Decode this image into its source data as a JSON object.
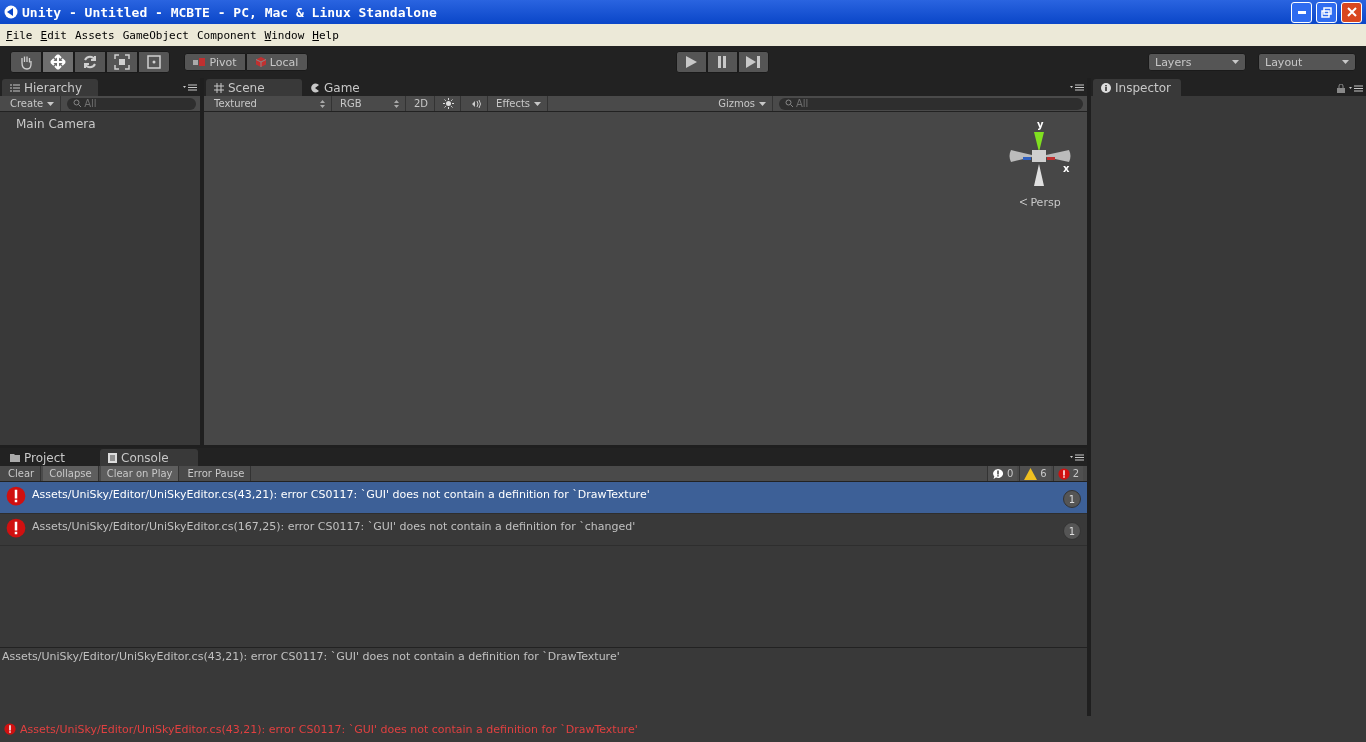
{
  "window": {
    "title": "Unity - Untitled - MCBTE - PC, Mac & Linux Standalone"
  },
  "menu": [
    {
      "label": "File",
      "mnemonic": true
    },
    {
      "label": "Edit",
      "mnemonic": true
    },
    {
      "label": "Assets",
      "mnemonic": false
    },
    {
      "label": "GameObject",
      "mnemonic": false
    },
    {
      "label": "Component",
      "mnemonic": false
    },
    {
      "label": "Window",
      "mnemonic": true
    },
    {
      "label": "Help",
      "mnemonic": true
    }
  ],
  "toolbar": {
    "tools": [
      {
        "kind": "hand",
        "selected": false
      },
      {
        "kind": "move",
        "selected": true
      },
      {
        "kind": "rotate",
        "selected": false
      },
      {
        "kind": "scale",
        "selected": false
      },
      {
        "kind": "rect",
        "selected": false
      }
    ],
    "pivot": "Pivot",
    "space": "Local",
    "playback": [
      {
        "kind": "play",
        "selected": false
      },
      {
        "kind": "pause",
        "selected": false
      },
      {
        "kind": "step",
        "selected": false
      }
    ],
    "layers": "Layers",
    "layout": "Layout"
  },
  "hierarchy": {
    "tab": "Hierarchy",
    "create": "Create",
    "search_placeholder": "All",
    "items": [
      "Main Camera"
    ]
  },
  "scene": {
    "tabs": [
      {
        "label": "Scene",
        "kind": "scene",
        "selected": true
      },
      {
        "label": "Game",
        "kind": "game",
        "selected": false
      }
    ],
    "draw_mode": "Textured",
    "render_mode": "RGB",
    "mode_2d": "2D",
    "mode_2d_on": false,
    "lighting_on": false,
    "audio_on": false,
    "effects": "Effects",
    "gizmos": "Gizmos",
    "search_placeholder": "All",
    "gizmo": {
      "y_label": "y",
      "x_label": "x",
      "projection": "Persp"
    }
  },
  "inspector": {
    "tab": "Inspector"
  },
  "console": {
    "tabs": [
      {
        "label": "Project",
        "kind": "project",
        "selected": false
      },
      {
        "label": "Console",
        "kind": "console",
        "selected": true
      }
    ],
    "buttons": [
      {
        "label": "Clear",
        "selected": false
      },
      {
        "label": "Collapse",
        "selected": true
      },
      {
        "label": "Clear on Play",
        "selected": true
      },
      {
        "label": "Error Pause",
        "selected": false
      }
    ],
    "counters": [
      {
        "kind": "info",
        "count": "0"
      },
      {
        "kind": "warning",
        "count": "6"
      },
      {
        "kind": "error",
        "count": "2"
      }
    ],
    "entries": [
      {
        "message": "Assets/UniSky/Editor/UniSkyEditor.cs(43,21): error CS0117: `GUI' does not contain a definition for `DrawTexture'",
        "count": "1",
        "selected": true
      },
      {
        "message": "Assets/UniSky/Editor/UniSkyEditor.cs(167,25): error CS0117: `GUI' does not contain a definition for `changed'",
        "count": "1",
        "selected": false
      }
    ],
    "detail": "Assets/UniSky/Editor/UniSkyEditor.cs(43,21): error CS0117: `GUI' does not contain a definition for `DrawTexture'"
  },
  "status_bar": {
    "message": "Assets/UniSky/Editor/UniSkyEditor.cs(43,21): error CS0117: `GUI' does not contain a definition for `DrawTexture'"
  }
}
